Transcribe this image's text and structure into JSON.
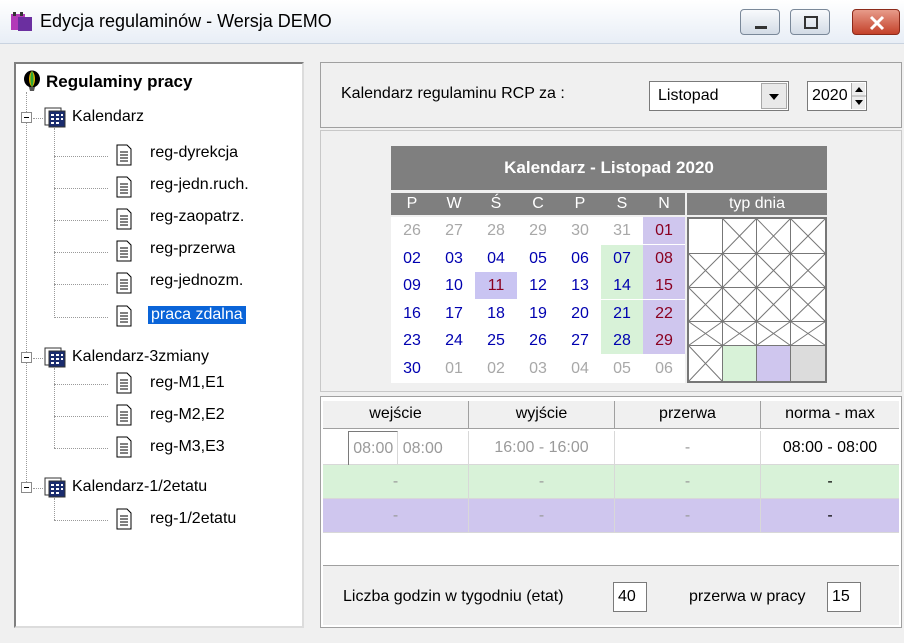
{
  "window": {
    "title": "Edycja regulaminów - Wersja DEMO"
  },
  "tree": {
    "root": "Regulaminy pracy",
    "groups": [
      {
        "label": "Kalendarz",
        "items": [
          "reg-dyrekcja",
          "reg-jedn.ruch.",
          "reg-zaopatrz.",
          "reg-przerwa",
          "reg-jednozm.",
          "praca zdalna"
        ]
      },
      {
        "label": "Kalendarz-3zmiany",
        "items": [
          "reg-M1,E1",
          "reg-M2,E2",
          "reg-M3,E3"
        ]
      },
      {
        "label": "Kalendarz-1/2etatu",
        "items": [
          "reg-1/2etatu"
        ]
      }
    ],
    "selected": "praca zdalna"
  },
  "top": {
    "label": "Kalendarz regulaminu RCP  za :",
    "month": "Listopad",
    "year": "2020"
  },
  "calendar": {
    "title": "Kalendarz - Listopad 2020",
    "day_headers": [
      "P",
      "W",
      "Ś",
      "C",
      "P",
      "S",
      "N"
    ],
    "type_header": "typ dnia",
    "weeks": [
      [
        "26",
        "27",
        "28",
        "29",
        "30",
        "31",
        "01"
      ],
      [
        "02",
        "03",
        "04",
        "05",
        "06",
        "07",
        "08"
      ],
      [
        "09",
        "10",
        "11",
        "12",
        "13",
        "14",
        "15"
      ],
      [
        "16",
        "17",
        "18",
        "19",
        "20",
        "21",
        "22"
      ],
      [
        "23",
        "24",
        "25",
        "26",
        "27",
        "28",
        "29"
      ],
      [
        "30",
        "01",
        "02",
        "03",
        "04",
        "05",
        "06"
      ]
    ],
    "colors": {
      "weekday": "#0000b0",
      "sunday": "#8a0020",
      "other_month": "#a8a8a8",
      "saturday_bg": "#d8f2d8",
      "sunday_bg": "#cfc6ee"
    }
  },
  "hours": {
    "headers": [
      "wejście",
      "wyjście",
      "przerwa",
      "norma - max"
    ],
    "rows": [
      {
        "in_from": "08:00",
        "in_to": "08:00",
        "out": "16:00 - 16:00",
        "break": "-",
        "norma": "08:00 - 08:00"
      },
      {
        "in": "-",
        "out": "-",
        "break": "-",
        "norma": "-"
      },
      {
        "in": "-",
        "out": "-",
        "break": "-",
        "norma": "-"
      }
    ]
  },
  "footer": {
    "hours_label": "Liczba godzin w tygodniu (etat)",
    "hours_value": "40",
    "break_label": "przerwa w pracy",
    "break_value": "15"
  }
}
